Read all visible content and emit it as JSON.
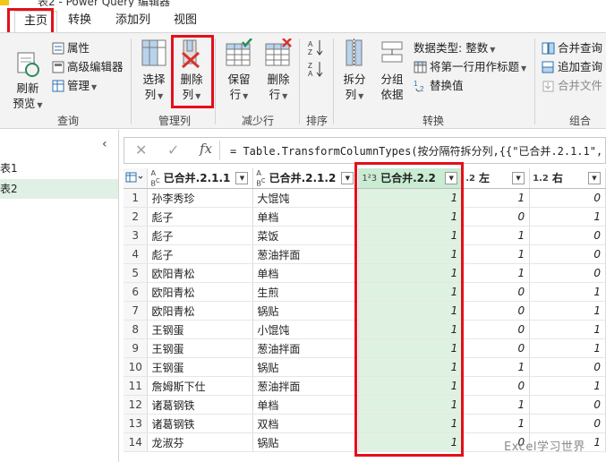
{
  "window": {
    "title": "表2 - Power Query 编辑器"
  },
  "tabs": [
    {
      "label": "主页"
    },
    {
      "label": "转换"
    },
    {
      "label": "添加列"
    },
    {
      "label": "视图"
    }
  ],
  "ribbon": {
    "query": {
      "refresh_line1": "刷新",
      "refresh_line2": "预览",
      "properties": "属性",
      "advanced_editor": "高级编辑器",
      "manage": "管理",
      "label": "查询"
    },
    "manage_columns": {
      "choose_line1": "选择",
      "choose_line2": "列",
      "remove_line1": "删除",
      "remove_line2": "列",
      "label": "管理列"
    },
    "reduce_rows": {
      "keep_line1": "保留",
      "keep_line2": "行",
      "remove_line1": "删除",
      "remove_line2": "行",
      "label": "减少行"
    },
    "sort": {
      "label": "排序"
    },
    "transform": {
      "split_line1": "拆分",
      "split_line2": "列",
      "group_line1": "分组",
      "group_line2": "依据",
      "datatype_label": "数据类型:",
      "datatype_value": "整数",
      "first_row_header": "将第一行用作标题",
      "replace_values": "替换值",
      "label": "转换"
    },
    "combine": {
      "merge_queries": "合并查询",
      "append_queries": "追加查询",
      "merge_files": "合并文件",
      "label": "组合"
    }
  },
  "queries": [
    {
      "label": "表1"
    },
    {
      "label": "表2"
    }
  ],
  "formula": "= Table.TransformColumnTypes(按分隔符拆分列,{{\"已合并.2.1.1\", typ",
  "grid": {
    "columns": [
      {
        "type": "ABC",
        "name": "已合并.2.1.1"
      },
      {
        "type": "ABC",
        "name": "已合并.2.1.2"
      },
      {
        "type": "123",
        "name": "已合并.2.2"
      },
      {
        "type": "1.2",
        "name": "左"
      },
      {
        "type": "1.2",
        "name": "右"
      }
    ],
    "rows": [
      {
        "n": "1",
        "c1": "孙李秀珍",
        "c2": "大馄饨",
        "c3": "1",
        "c4": "1",
        "c5": "0"
      },
      {
        "n": "2",
        "c1": "彪子",
        "c2": "单档",
        "c3": "1",
        "c4": "0",
        "c5": "1"
      },
      {
        "n": "3",
        "c1": "彪子",
        "c2": "菜饭",
        "c3": "1",
        "c4": "1",
        "c5": "0"
      },
      {
        "n": "4",
        "c1": "彪子",
        "c2": "葱油拌面",
        "c3": "1",
        "c4": "1",
        "c5": "0"
      },
      {
        "n": "5",
        "c1": "欧阳青松",
        "c2": "单档",
        "c3": "1",
        "c4": "1",
        "c5": "0"
      },
      {
        "n": "6",
        "c1": "欧阳青松",
        "c2": "生煎",
        "c3": "1",
        "c4": "0",
        "c5": "1"
      },
      {
        "n": "7",
        "c1": "欧阳青松",
        "c2": "锅贴",
        "c3": "1",
        "c4": "0",
        "c5": "1"
      },
      {
        "n": "8",
        "c1": "王钢蛋",
        "c2": "小馄饨",
        "c3": "1",
        "c4": "0",
        "c5": "1"
      },
      {
        "n": "9",
        "c1": "王钢蛋",
        "c2": "葱油拌面",
        "c3": "1",
        "c4": "0",
        "c5": "1"
      },
      {
        "n": "10",
        "c1": "王钢蛋",
        "c2": "锅贴",
        "c3": "1",
        "c4": "1",
        "c5": "0"
      },
      {
        "n": "11",
        "c1": "詹姆斯下仕",
        "c2": "葱油拌面",
        "c3": "1",
        "c4": "0",
        "c5": "1"
      },
      {
        "n": "12",
        "c1": "诸葛钢铁",
        "c2": "单档",
        "c3": "1",
        "c4": "1",
        "c5": "0"
      },
      {
        "n": "13",
        "c1": "诸葛钢铁",
        "c2": "双档",
        "c3": "1",
        "c4": "1",
        "c5": "0"
      },
      {
        "n": "14",
        "c1": "龙淑芬",
        "c2": "锅贴",
        "c3": "1",
        "c4": "0",
        "c5": "1"
      }
    ]
  },
  "watermark": "Excel学习世界",
  "colors": {
    "highlight_box": "#e3101b",
    "selected_column": "#dff2e2",
    "selected_query": "#dff0e5"
  }
}
